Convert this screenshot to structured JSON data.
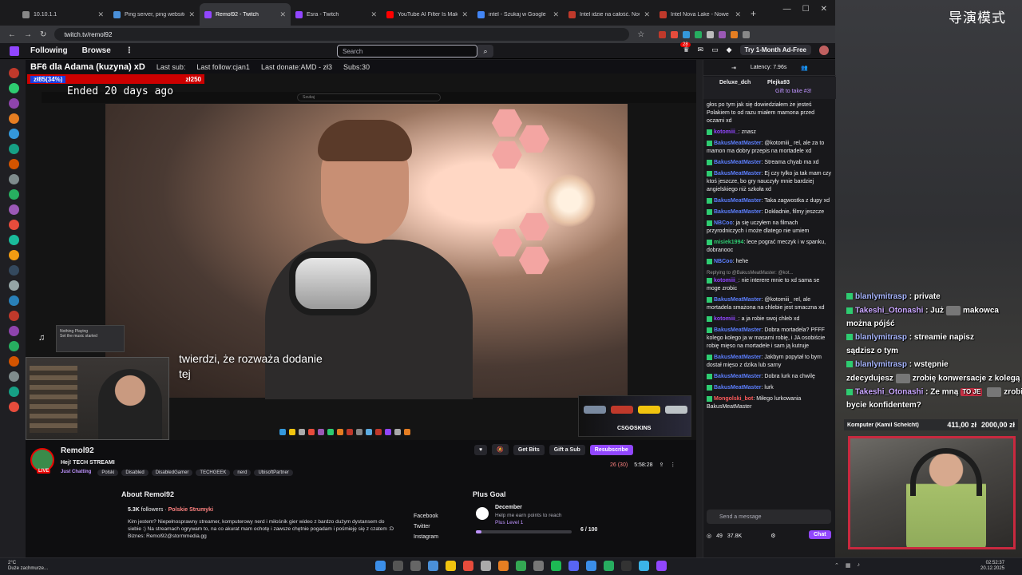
{
  "overlay": {
    "mode_title": "导演模式",
    "chat": [
      {
        "user": "blanlymitrasp",
        "text": "private",
        "uc": "u"
      },
      {
        "user": "Takeshi_Otonashi",
        "text": "Już",
        "text2": "makowca",
        "uc": "u2"
      },
      {
        "user": "",
        "text": "można pójść",
        "uc": "u"
      },
      {
        "user": "blanlymitrasp",
        "text": "streamie napisz",
        "uc": "u"
      },
      {
        "user": "",
        "text": "sądzisz o tym",
        "uc": "u"
      },
      {
        "user": "blanlymitrasp",
        "text": "wstępnie",
        "uc": "u"
      },
      {
        "user": "",
        "text": "zdecydujesz",
        "text2": "zrobię konwersacje z kolegą",
        "uc": "u"
      },
      {
        "user": "Takeshi_Otonashi",
        "text": "Ze mną",
        "badge": "TO JE",
        "text2": "zrobisz",
        "uc": "u2"
      },
      {
        "user": "",
        "text": "bycie konfidentem?",
        "uc": "u"
      }
    ],
    "donation": {
      "name": "Komputer (Kamil Schelcht)",
      "current": "411,00 zł",
      "goal": "2000,00 zł"
    }
  },
  "browser": {
    "tabs": [
      {
        "label": "10.10.1.1",
        "color": "#888"
      },
      {
        "label": "Ping server, ping website : Ch",
        "color": "#4a90d9"
      },
      {
        "label": "Remol92 - Twitch",
        "color": "#9146ff",
        "active": true
      },
      {
        "label": "Esra - Twitch",
        "color": "#9146ff"
      },
      {
        "label": "YouTube AI Filter Is Making I",
        "color": "#ff0000"
      },
      {
        "label": "intel - Szukaj w Google",
        "color": "#4285f4"
      },
      {
        "label": "Intel idzie na całość. Nowa Li",
        "color": "#c0392b"
      },
      {
        "label": "Intel Nova Lake - Nowe infor",
        "color": "#c0392b"
      }
    ],
    "url": "twitch.tv/remol92"
  },
  "twitch": {
    "nav": {
      "following": "Following",
      "browse": "Browse",
      "search_placeholder": "Search",
      "ad_free": "Try 1-Month Ad-Free",
      "notif_count": "28"
    },
    "stream_overlay": {
      "title": "BF6 dla Adama (kuzyna) xD",
      "last_sub": "Last sub:",
      "last_follow": "Last follow:cjan1",
      "last_donate": "Last donate:AMD - zł3",
      "subs": "Subs:30",
      "goal_left": "zł85(34%)",
      "goal_right": "zł250"
    },
    "video": {
      "ended": "Ended 20 days ago",
      "youtube_search": "Szukaj",
      "subtitle_1": "twierdzi, że rozważa dodanie",
      "subtitle_2": "tej",
      "csgo": "CSG✪SKINS",
      "music": "Nothing Playing",
      "music_sub": "Set the music started"
    },
    "channel": {
      "name": "Remol92",
      "title": "Hej! TECH STREAMI",
      "category": "Just Chatting",
      "tags": [
        "Polski",
        "Disabled",
        "DisabledGamer",
        "TECHGEEK",
        "nerd",
        "UbisoftPartner"
      ],
      "live": "LIVE",
      "viewers": "26 (30)",
      "uptime": "5:58:28",
      "get_bits": "Get Bits",
      "gift_sub": "Gift a Sub",
      "subscribe": "Resubscribe"
    },
    "about": {
      "heading": "About Remol92",
      "followers": "5.3K",
      "followers_label": "followers",
      "region": "Polskie Strumyki",
      "bio": "Kim jestem? Niepełnosprawny streamer, komputerowy nerd i miłośnik gier wideo z bardzo dużym dystansem do siebie :) Na streamach ogrywam to, na co akurat mam ochotę i zawsze chętnie pogadam i pośmieję się z czatem :D Biznes: Remol92@stormmedia.gg",
      "links": [
        "Facebook",
        "Twitter",
        "Instagram"
      ]
    },
    "goal": {
      "heading": "Plus Goal",
      "month": "December",
      "text": "Help me earn points to reach",
      "level": "Plus Level 1",
      "count": "6 / 100",
      "progress": 0.06
    },
    "chat": {
      "latency": "Latency: 7.96s",
      "hype_user1": "Deluxe_dch",
      "hype_user2": "Plejka93",
      "hype_gift": "Gift to take #3!",
      "messages": [
        {
          "user": "",
          "text": "głos po tym jak się dowiedziałem że jesteś Polakiem to od razu miałem mamona przed oczami xd"
        },
        {
          "user": "kotomiii_",
          "text": ": znasz",
          "c": "v"
        },
        {
          "user": "BakusMeatMaster",
          "text": ": @kotomiii_ rel, ale za to mamon ma dobry przepis na mortadele xd"
        },
        {
          "user": "BakusMeatMaster",
          "text": ": Streama chyab ma xd"
        },
        {
          "user": "BakusMeatMaster",
          "text": ": Ej czy tylko ja tak mam czy ktoś jeszcze, bo gry nauczyły mnie bardziej angielskiego niż szkoła xd"
        },
        {
          "user": "BakusMeatMaster",
          "text": ": Taka zagwostka z dupy xd"
        },
        {
          "user": "BakusMeatMaster",
          "text": ": Dokładnie, filmy jeszcze"
        },
        {
          "user": "NBCoo",
          "text": ": ja się uczyłem na filmach przyrodniczych i może dlatego nie umiem"
        },
        {
          "user": "misiek1994",
          "text": ": lece pograć meczyk i w spanku, dobranooc",
          "c": "g"
        },
        {
          "user": "NBCoo",
          "text": ": hehe"
        },
        {
          "user": "kotomiii_",
          "reply": "Replying to @BakusMeatMaster: @kot...",
          "text": ": nie interere mnie to xd sama se moge zrobic",
          "c": "v"
        },
        {
          "user": "BakusMeatMaster",
          "text": ": @kotomiii_ rel, ale mortadela smażona na chlebie jest smaczna xd"
        },
        {
          "user": "kotomiii_",
          "text": ": a ja robie swoj chleb xd",
          "c": "v"
        },
        {
          "user": "BakusMeatMaster",
          "text": ": Dobra mortadela? PFFF kolego kolego ja w masarni robię, i JA osobiście robię mięso na mortadele i sam ją kutruje"
        },
        {
          "user": "BakusMeatMaster",
          "text": ": Jakbym popytał to bym dostał mięso z dzika lub sarny"
        },
        {
          "user": "BakusMeatMaster",
          "text": ": Dobra lurk na chwilę"
        },
        {
          "user": "BakusMeatMaster",
          "text": ": lurk"
        },
        {
          "user": "Mongolski_bot",
          "text": ": Miłego lurkowania BakusMeatMaster",
          "c": "r"
        }
      ],
      "input_placeholder": "Send a message",
      "points": "49",
      "bits": "37.8K",
      "chat_btn": "Chat"
    }
  },
  "taskbar": {
    "weather_temp": "2°C",
    "weather_text": "Duże zachmurze...",
    "time": "02:52:37",
    "date": "20.12.2025"
  }
}
